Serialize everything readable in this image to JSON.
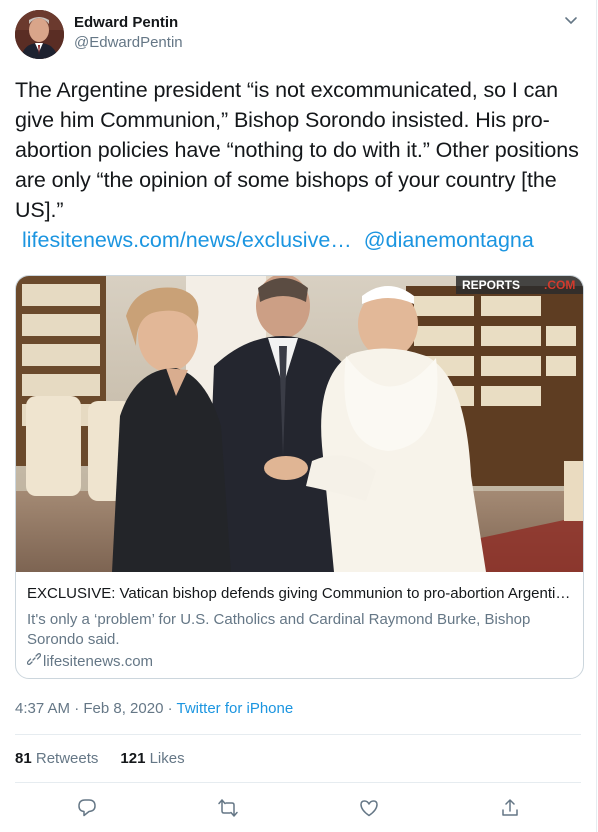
{
  "author": {
    "name": "Edward Pentin",
    "handle": "@EdwardPentin"
  },
  "tweet": {
    "text": "The Argentine president “is not excommunicated, so I can give him Communion,” Bishop Sorondo insisted. His pro-abortion policies have “nothing to do with it.” Other positions are only “the opinion of some bishops of your country [the US].”",
    "link": "lifesitenews.com/news/exclusive…",
    "mention": "@dianemontagna"
  },
  "card": {
    "image_watermark": "REPORTS",
    "title": "EXCLUSIVE: Vatican bishop defends giving Communion to pro-abortion Argentin...",
    "description": "It's only a ‘problem’ for U.S. Catholics and Cardinal Raymond Burke, Bishop Sorondo said.",
    "domain": "lifesitenews.com"
  },
  "meta": {
    "time": "4:37 AM · Feb 8, 2020 · ",
    "source": "Twitter for iPhone"
  },
  "stats": {
    "retweets_count": "81",
    "retweets_label": "Retweets",
    "likes_count": "121",
    "likes_label": "Likes"
  },
  "actions": [
    "reply-icon",
    "retweet-icon",
    "like-icon",
    "share-icon"
  ],
  "colors": {
    "link": "#1b95e0",
    "secondary": "#657786",
    "border": "#e6ecf0"
  }
}
